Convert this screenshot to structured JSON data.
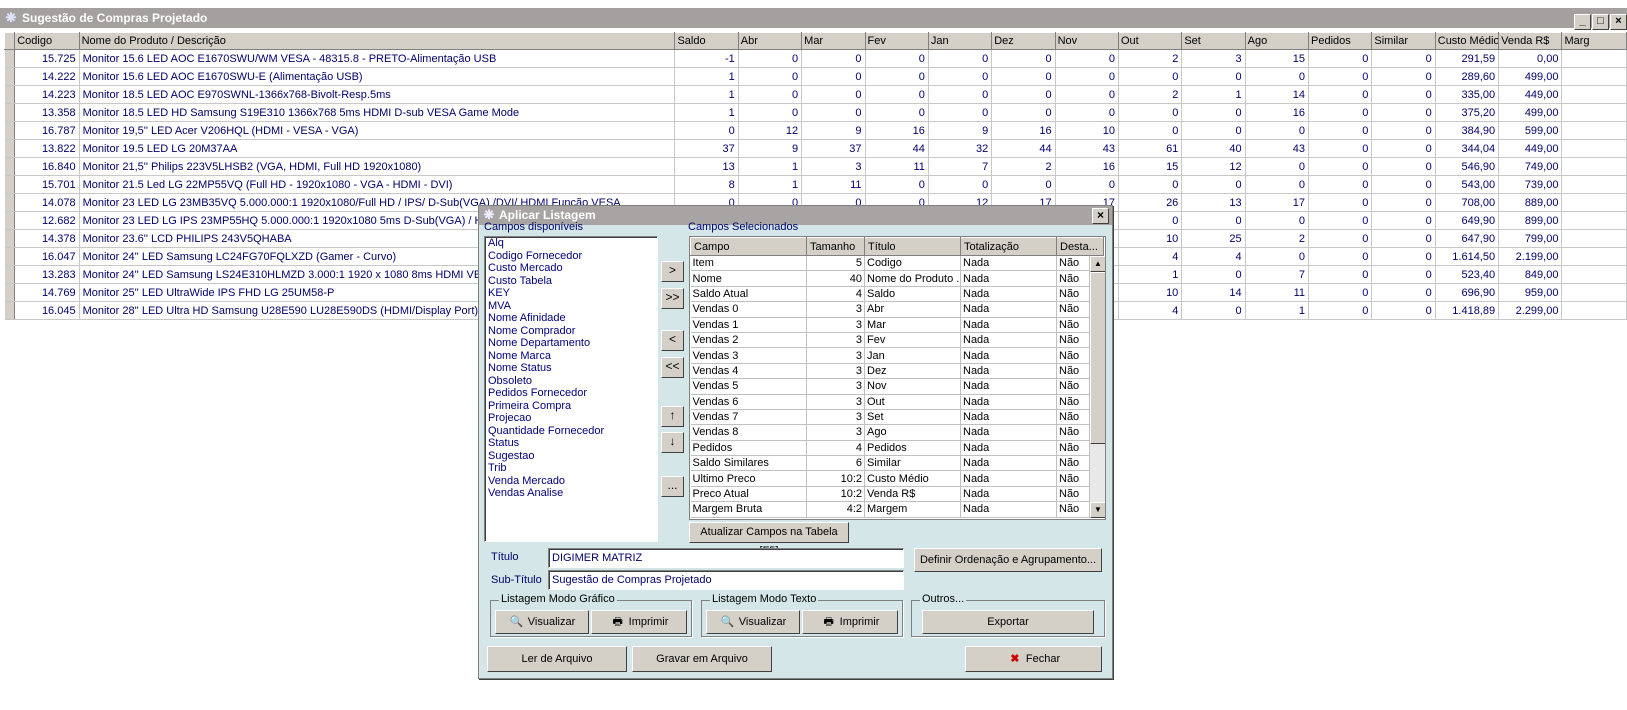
{
  "window": {
    "title": "Sugestão de Compras Projetado"
  },
  "grid": {
    "columns": [
      "Codigo",
      "Nome do Produto / Descrição",
      "Saldo",
      "Abr",
      "Mar",
      "Fev",
      "Jan",
      "Dez",
      "Nov",
      "Out",
      "Set",
      "Ago",
      "Pedidos",
      "Similar",
      "Custo Médio",
      "Venda R$",
      "Marg"
    ],
    "rows": [
      [
        "15.725",
        "Monitor 15.6 LED AOC E1670SWU/WM VESA - 48315.8 - PRETO-Alimentação USB",
        "-1",
        "0",
        "0",
        "0",
        "0",
        "0",
        "0",
        "2",
        "3",
        "15",
        "0",
        "0",
        "291,59",
        "0,00"
      ],
      [
        "14.222",
        "Monitor 15.6 LED AOC E1670SWU-E (Alimentação USB)",
        "1",
        "0",
        "0",
        "0",
        "0",
        "0",
        "0",
        "0",
        "0",
        "0",
        "0",
        "0",
        "289,60",
        "499,00"
      ],
      [
        "14.223",
        "Monitor 18.5 LED AOC E970SWNL-1366x768-Bivolt-Resp.5ms",
        "1",
        "0",
        "0",
        "0",
        "0",
        "0",
        "0",
        "2",
        "1",
        "14",
        "0",
        "0",
        "335,00",
        "449,00"
      ],
      [
        "13.358",
        "Monitor 18.5 LED HD Samsung S19E310 1366x768  5ms HDMI D-sub VESA Game Mode",
        "1",
        "0",
        "0",
        "0",
        "0",
        "0",
        "0",
        "0",
        "0",
        "16",
        "0",
        "0",
        "375,20",
        "499,00"
      ],
      [
        "16.787",
        "Monitor 19,5'' LED Acer  V206HQL (HDMI - VESA - VGA)",
        "0",
        "12",
        "9",
        "16",
        "9",
        "16",
        "10",
        "0",
        "0",
        "0",
        "0",
        "0",
        "384,90",
        "599,00"
      ],
      [
        "13.822",
        "Monitor 19.5 LED LG 20M37AA",
        "37",
        "9",
        "37",
        "44",
        "32",
        "44",
        "43",
        "61",
        "40",
        "43",
        "0",
        "0",
        "344,04",
        "449,00"
      ],
      [
        "16.840",
        "Monitor 21,5'' Philips 223V5LHSB2 (VGA, HDMI, Full HD 1920x1080)",
        "13",
        "1",
        "3",
        "11",
        "7",
        "2",
        "16",
        "15",
        "12",
        "0",
        "0",
        "0",
        "546,90",
        "749,00"
      ],
      [
        "15.701",
        "Monitor 21.5 Led LG  22MP55VQ (Full HD - 1920x1080 - VGA - HDMI - DVI)",
        "8",
        "1",
        "11",
        "0",
        "0",
        "0",
        "0",
        "0",
        "0",
        "0",
        "0",
        "0",
        "543,00",
        "739,00"
      ],
      [
        "14.078",
        "Monitor 23 LED LG 23MB35VQ 5.000.000:1 1920x1080/Full HD  / IPS/ D-Sub(VGA) /DVI/ HDMI Função VESA",
        "0",
        "0",
        "0",
        "0",
        "12",
        "17",
        "17",
        "26",
        "13",
        "17",
        "0",
        "0",
        "708,00",
        "889,00"
      ],
      [
        "12.682",
        "Monitor 23 LED LG IPS 23MP55HQ 5.000.000:1 1920x1080  5ms D-Sub(VGA) / HDMI",
        "",
        "",
        "",
        "",
        "",
        "",
        "",
        "0",
        "0",
        "0",
        "0",
        "0",
        "649,90",
        "899,00"
      ],
      [
        "14.378",
        "Monitor 23.6'' LCD PHILIPS 243V5QHABA",
        "",
        "",
        "",
        "",
        "",
        "",
        "",
        "10",
        "25",
        "2",
        "0",
        "0",
        "647,90",
        "799,00"
      ],
      [
        "16.047",
        "Monitor 24'' LED Samsung LC24FG70FQLXZD (Gamer - Curvo)",
        "",
        "",
        "",
        "",
        "",
        "",
        "",
        "4",
        "4",
        "0",
        "0",
        "0",
        "1.614,50",
        "2.199,00"
      ],
      [
        "13.283",
        "Monitor 24'' LED Samsung LS24E310HLMZD 3.000:1 1920 x 1080  8ms  HDMI VESA",
        "",
        "",
        "",
        "",
        "",
        "",
        "",
        "1",
        "0",
        "7",
        "0",
        "0",
        "523,40",
        "849,00"
      ],
      [
        "14.769",
        "Monitor 25'' LED UltraWide IPS FHD LG 25UM58-P",
        "",
        "",
        "",
        "",
        "",
        "",
        "",
        "10",
        "14",
        "11",
        "0",
        "0",
        "696,90",
        "959,00"
      ],
      [
        "16.045",
        "Monitor 28'' LED Ultra HD Samsung U28E590 LU28E590DS (HDMI/Display Port)",
        "",
        "",
        "",
        "",
        "",
        "",
        "",
        "4",
        "0",
        "1",
        "0",
        "0",
        "1.418,89",
        "2.299,00"
      ]
    ]
  },
  "dialog": {
    "title": "Aplicar Listagem",
    "available_label": "Campos disponíveis",
    "available": [
      "Alq",
      "Codigo Fornecedor",
      "Custo Mercado",
      "Custo Tabela",
      "KEY",
      "MVA",
      "Nome Afinidade",
      "Nome Comprador",
      "Nome Departamento",
      "Nome Marca",
      "Nome Status",
      "Obsoleto",
      "Pedidos Fornecedor",
      "Primeira Compra",
      "Projecao",
      "Quantidade Fornecedor",
      "Status",
      "Sugestao",
      "Trib",
      "Venda Mercado",
      "Vendas Analise"
    ],
    "selected_label": "Campos Selecionados",
    "selected_columns": [
      "Campo",
      "Tamanho",
      "Título",
      "Totalização",
      "Desta..."
    ],
    "selected": [
      [
        "Item",
        "5",
        "Codigo",
        "Nada",
        "Não"
      ],
      [
        "Nome",
        "40",
        "Nome do Produto ...",
        "Nada",
        "Não"
      ],
      [
        "Saldo Atual",
        "4",
        "Saldo",
        "Nada",
        "Não"
      ],
      [
        "Vendas 0",
        "3",
        "Abr",
        "Nada",
        "Não"
      ],
      [
        "Vendas 1",
        "3",
        "Mar",
        "Nada",
        "Não"
      ],
      [
        "Vendas 2",
        "3",
        "Fev",
        "Nada",
        "Não"
      ],
      [
        "Vendas 3",
        "3",
        "Jan",
        "Nada",
        "Não"
      ],
      [
        "Vendas 4",
        "3",
        "Dez",
        "Nada",
        "Não"
      ],
      [
        "Vendas 5",
        "3",
        "Nov",
        "Nada",
        "Não"
      ],
      [
        "Vendas 6",
        "3",
        "Out",
        "Nada",
        "Não"
      ],
      [
        "Vendas 7",
        "3",
        "Set",
        "Nada",
        "Não"
      ],
      [
        "Vendas 8",
        "3",
        "Ago",
        "Nada",
        "Não"
      ],
      [
        "Pedidos",
        "4",
        "Pedidos",
        "Nada",
        "Não"
      ],
      [
        "Saldo Similares",
        "6",
        "Similar",
        "Nada",
        "Não"
      ],
      [
        "Ultimo Preco",
        "10:2",
        "Custo Médio",
        "Nada",
        "Não"
      ],
      [
        "Preco Atual",
        "10:2",
        "Venda R$",
        "Nada",
        "Não"
      ],
      [
        "Margem Bruta",
        "4:2",
        "Margem",
        "Nada",
        "Não"
      ]
    ],
    "move_buttons": [
      ">",
      ">>",
      "<",
      "<<",
      "↑",
      "↓",
      "..."
    ],
    "update_button": "Atualizar Campos na Tabela [F5]",
    "titulo_label": "Título",
    "titulo_value": "DIGIMER MATRIZ",
    "subtitulo_label": "Sub-Título",
    "subtitulo_value": "Sugestão de Compras Projetado",
    "ordenacao_button": "Definir Ordenação e Agrupamento...",
    "grafico_group": "Listagem Modo Gráfico",
    "texto_group": "Listagem Modo Texto",
    "outros_group": "Outros...",
    "visualizar": "Visualizar",
    "imprimir": "Imprimir",
    "exportar": "Exportar",
    "ler_arquivo": "Ler de Arquivo",
    "gravar_arquivo": "Gravar em Arquivo",
    "fechar": "Fechar"
  }
}
